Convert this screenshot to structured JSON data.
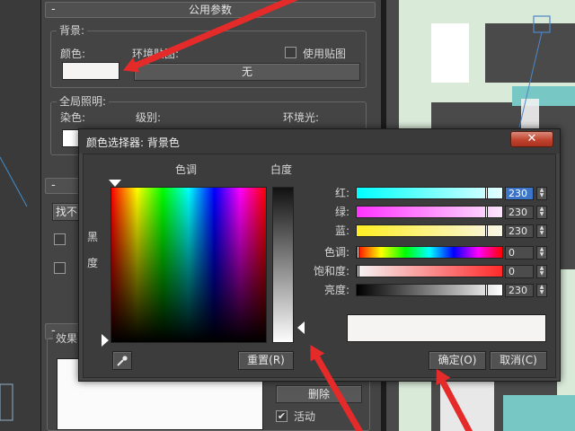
{
  "command_panel": {
    "common_params": {
      "header": "公用参数",
      "collapse_glyph": "-",
      "background_group": {
        "label": "背景:",
        "color_label": "颜色:",
        "env_map_label": "环境贴图:",
        "use_map_label": "使用贴图",
        "use_map_checked": false,
        "map_button": "无",
        "swatch_color": "#f6f3f3"
      },
      "global_lighting_group": {
        "label": "全局照明:",
        "tint_label": "染色:",
        "level_label": "级别:",
        "ambient_label": "环境光:",
        "tint_color": "#ffffff"
      }
    },
    "second_rollout": {
      "collapse_glyph": "-",
      "dropdown_partial": "找不",
      "option_1_partial": "黑",
      "option_2_partial": "度"
    },
    "effects_rollout": {
      "collapse_glyph": "-",
      "effects_label": "效果",
      "delete_button": "删除",
      "active_label": "活动",
      "active_checked": true
    }
  },
  "color_picker": {
    "title": "颜色选择器: 背景色",
    "close_glyph": "✕",
    "hue_heading": "色调",
    "whiteness_heading": "白度",
    "blackness_label": "黑",
    "degree_label": "度",
    "sliders": [
      {
        "key": "red",
        "label": "红:",
        "value": "230",
        "level": 0.902,
        "selected": true
      },
      {
        "key": "green",
        "label": "绿:",
        "value": "230",
        "level": 0.902,
        "selected": false
      },
      {
        "key": "blue",
        "label": "蓝:",
        "value": "230",
        "level": 0.902,
        "selected": false
      },
      {
        "key": "hue",
        "label": "色调:",
        "value": "0",
        "level": 0.0,
        "selected": false
      },
      {
        "key": "saturation",
        "label": "饱和度:",
        "value": "0",
        "level": 0.0,
        "selected": false
      },
      {
        "key": "value",
        "label": "亮度:",
        "value": "230",
        "level": 0.902,
        "selected": false
      }
    ],
    "preview_color": "#f6f3f3",
    "reset_button": "重置(R)",
    "ok_button": "确定(O)",
    "cancel_button": "取消(C)",
    "eyedropper_icon": "eyedropper-icon"
  },
  "annotation_color": "#e52a2a"
}
